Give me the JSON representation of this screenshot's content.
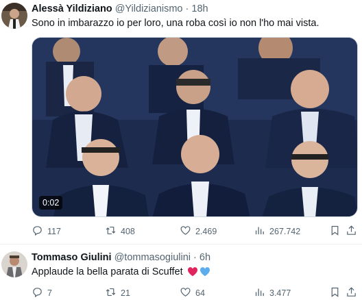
{
  "tweets": [
    {
      "name": "Alessà Yildiziano",
      "handle": "@Yildizianismo",
      "sep": "·",
      "time": "18h",
      "text": "Sono in imbarazzo io per loro, una roba così io non l'ho mai vista.",
      "video_time": "0:02",
      "stats": {
        "replies": "117",
        "retweets": "408",
        "likes": "2.469",
        "views": "267.742"
      }
    },
    {
      "name": "Tommaso Giulini",
      "handle": "@tommasogiulini",
      "sep": "·",
      "time": "6h",
      "text": "Applaude la bella parata di Scuffet",
      "emoji": [
        "red-heart",
        "blue-heart"
      ],
      "stats": {
        "replies": "7",
        "retweets": "21",
        "likes": "64",
        "views": "3.477"
      }
    }
  ],
  "colors": {
    "text": "#0f1419",
    "muted": "#536471",
    "divider": "#eff3f4",
    "red_heart": "#e0245e",
    "blue_heart": "#5dadec"
  }
}
